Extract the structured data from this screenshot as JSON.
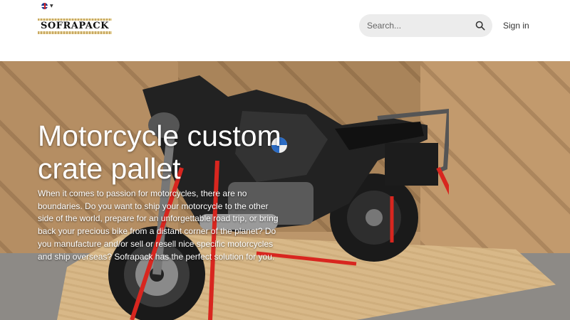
{
  "header": {
    "language_icon": "uk-flag-icon",
    "logo_text": "SOFRAPACK",
    "search": {
      "placeholder": "Search..."
    },
    "signin_label": "Sign in"
  },
  "hero": {
    "title": "Motorcycle custom crate pallet",
    "description": "When it comes to passion for motorcycles, there are no boundaries. Do you want to ship your motorcycle to the other side of the world, prepare for an unforgettable road trip, or bring back your precious bike from a distant corner of the planet? Do you manufacture and/or sell or resell nice specific motorcycles and ship overseas? Sofrapack has the perfect solution for you."
  },
  "colors": {
    "strap_red": "#d8261f",
    "crate_brown": "#b58e63",
    "logo_gold": "#c9a961"
  }
}
